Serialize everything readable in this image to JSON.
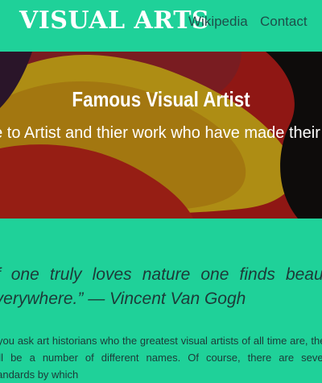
{
  "header": {
    "logo": "VISUAL ARTS",
    "nav": [
      "Wikipedia",
      "Contact"
    ]
  },
  "hero": {
    "title": "Famous Visual Artist",
    "text": "It was a tribute to Artist and thier work who have made their creation of Art"
  },
  "quote": {
    "text": "“If one truly loves nature one finds beauty everywhere.” — Vincent Van Gogh"
  },
  "intro": {
    "text": "If you ask art historians who the greatest visual artists of all time are, there will be a number of different names. Of course, there are several standards by which"
  },
  "colors": {
    "background": "#1fd199",
    "logo": "#ffffff",
    "nav_text": "#1d4f4a",
    "body_text": "#1d3a38"
  }
}
